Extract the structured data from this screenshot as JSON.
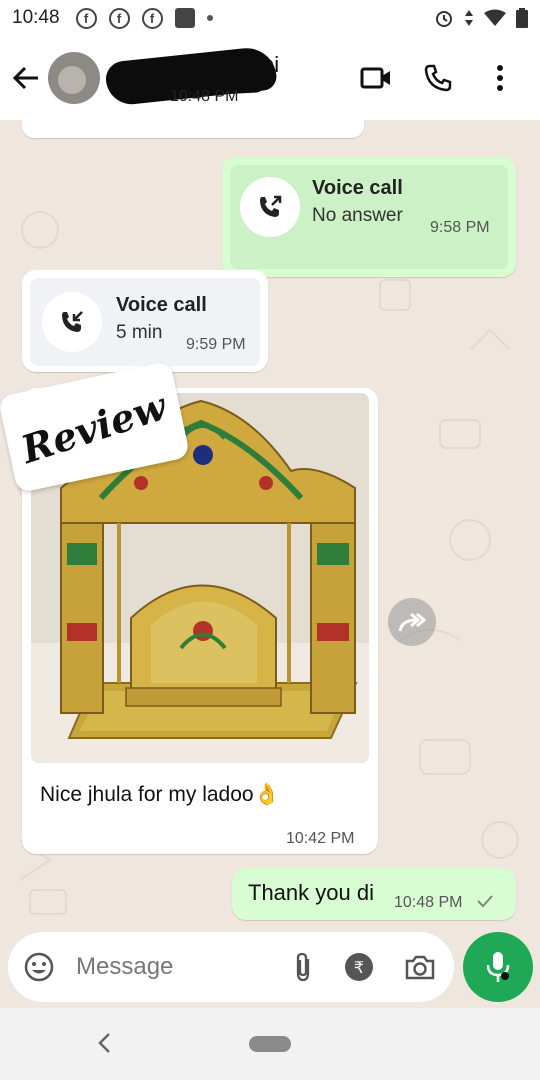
{
  "status_bar": {
    "time": "10:48",
    "notification_icons": [
      "facebook-icon",
      "facebook-icon",
      "facebook-icon",
      "photo-icon",
      "dot-icon"
    ],
    "system_icons": [
      "alarm-icon",
      "data-arrows-icon",
      "wifi-icon",
      "battery-icon"
    ]
  },
  "header": {
    "contact_name_visible": "hi",
    "contact_status": "10:48 PM",
    "actions": [
      "video-call-icon",
      "phone-icon",
      "more-vert-icon"
    ]
  },
  "messages": [
    {
      "direction": "outgoing",
      "type": "call",
      "title": "Voice call",
      "subtitle": "No answer",
      "time": "9:58 PM",
      "icon": "outgoing-call-icon"
    },
    {
      "direction": "incoming",
      "type": "call",
      "title": "Voice call",
      "subtitle": "5 min",
      "time": "9:59 PM",
      "icon": "incoming-call-icon"
    },
    {
      "direction": "incoming",
      "type": "image",
      "sticker_label": "Review",
      "caption": "Nice jhula for my ladoo👌",
      "time": "10:42 PM"
    },
    {
      "direction": "outgoing",
      "type": "text",
      "text": "Thank you di",
      "time": "10:48 PM",
      "status": "sent"
    }
  ],
  "composer": {
    "placeholder": "Message",
    "icons": [
      "emoji-icon",
      "attach-icon",
      "rupee-icon",
      "camera-icon",
      "mic-icon"
    ]
  },
  "colors": {
    "outgoing_bubble": "#d9fdd3",
    "incoming_bubble": "#ffffff",
    "chat_background": "#efe7de",
    "accent_green": "#1fa855"
  }
}
